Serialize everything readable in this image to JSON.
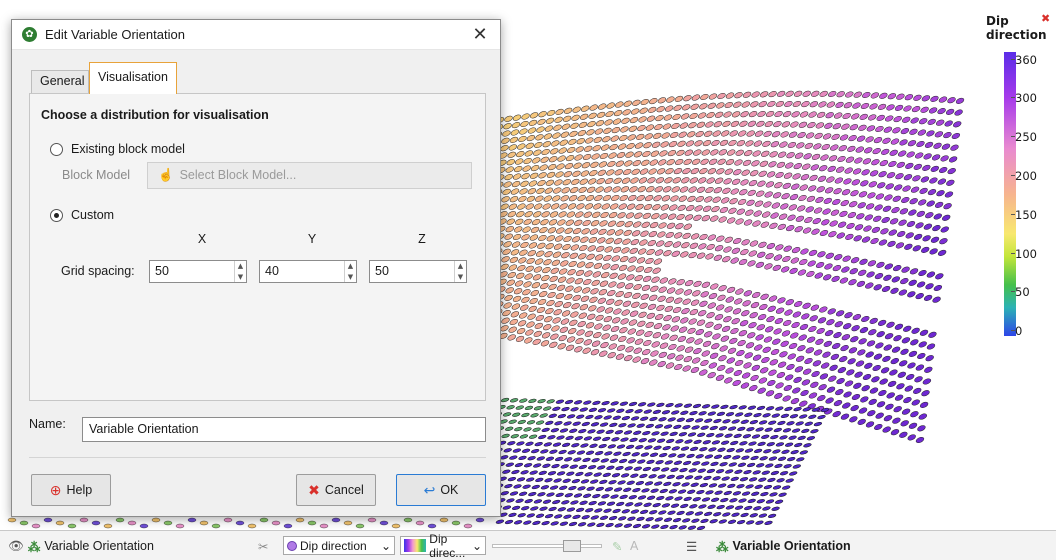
{
  "dialog": {
    "title": "Edit Variable Orientation",
    "close_glyph": "✕",
    "tabs": [
      {
        "label": "General",
        "active": false
      },
      {
        "label": "Visualisation",
        "active": true
      }
    ],
    "heading": "Choose a distribution for visualisation",
    "option_existing": "Existing block model",
    "block_model_label": "Block Model",
    "block_model_button": "Select Block Model...",
    "option_custom": "Custom",
    "selected_option": "Custom",
    "axes": [
      "X",
      "Y",
      "Z"
    ],
    "grid_spacing_label": "Grid spacing:",
    "grid_spacing": {
      "x": "50",
      "y": "40",
      "z": "50"
    },
    "name_label": "Name:",
    "name_value": "Variable Orientation",
    "help_label": "Help",
    "cancel_label": "Cancel",
    "ok_label": "OK"
  },
  "legend": {
    "title": "Dip direction",
    "ticks": [
      "360",
      "300",
      "250",
      "200",
      "150",
      "100",
      "50",
      "0"
    ]
  },
  "bottombar": {
    "object_name": "Variable Orientation",
    "dropdown1": "Dip direction",
    "dropdown2": "Dip direc...",
    "right_object_name": "Variable Orientation"
  },
  "colors": {
    "dialog_bg": "#f0f0f0",
    "active_tab_border": "#e8a33a",
    "ok_border": "#2a7bd4"
  }
}
